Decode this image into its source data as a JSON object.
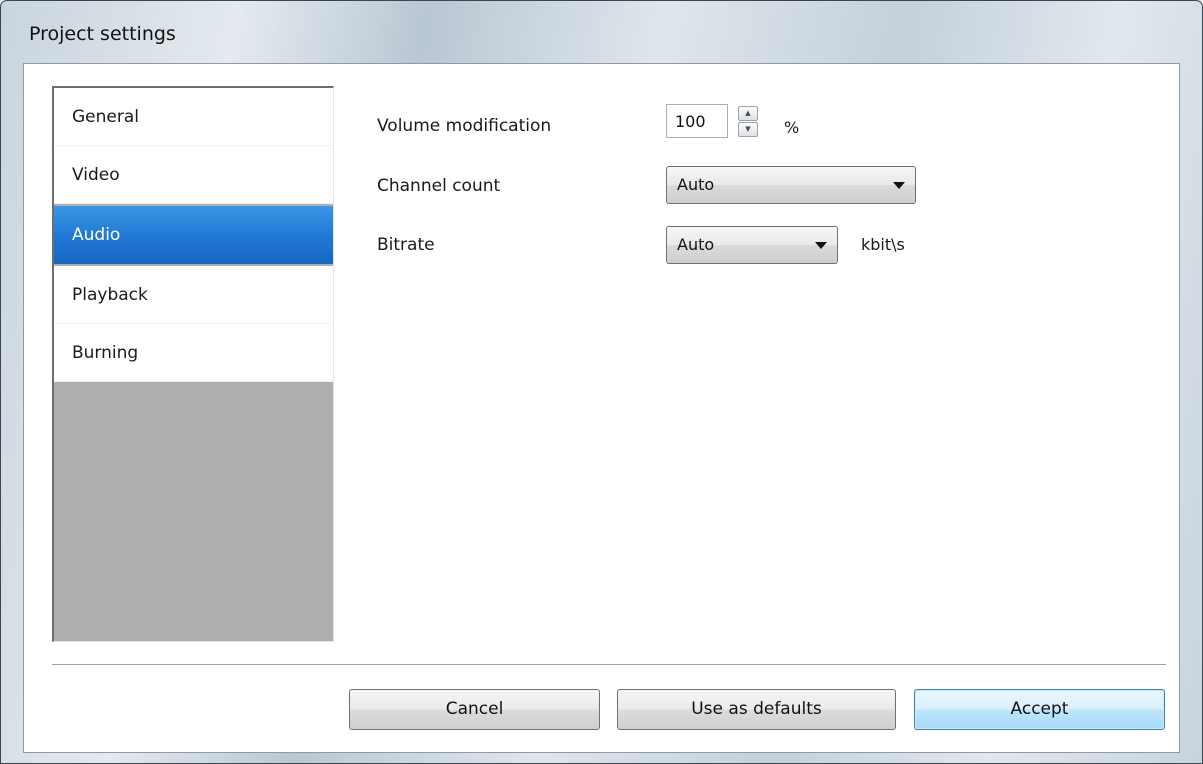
{
  "window": {
    "title": "Project settings"
  },
  "nav": {
    "items": [
      {
        "label": "General",
        "selected": false
      },
      {
        "label": "Video",
        "selected": false
      },
      {
        "label": "Audio",
        "selected": true
      },
      {
        "label": "Playback",
        "selected": false
      },
      {
        "label": "Burning",
        "selected": false
      }
    ]
  },
  "audio": {
    "volume": {
      "label": "Volume modification",
      "value": "100",
      "unit": "%"
    },
    "channels": {
      "label": "Channel count",
      "value": "Auto"
    },
    "bitrate": {
      "label": "Bitrate",
      "value": "Auto",
      "unit": "kbit\\s"
    }
  },
  "buttons": {
    "cancel": "Cancel",
    "defaults": "Use as defaults",
    "accept": "Accept"
  },
  "icons": {
    "spin_up": "spin-up-arrow",
    "spin_down": "spin-down-arrow",
    "dropdown": "dropdown-arrow"
  },
  "colors": {
    "selection": "#1f78d3",
    "nav_empty": "#aeaeae"
  }
}
